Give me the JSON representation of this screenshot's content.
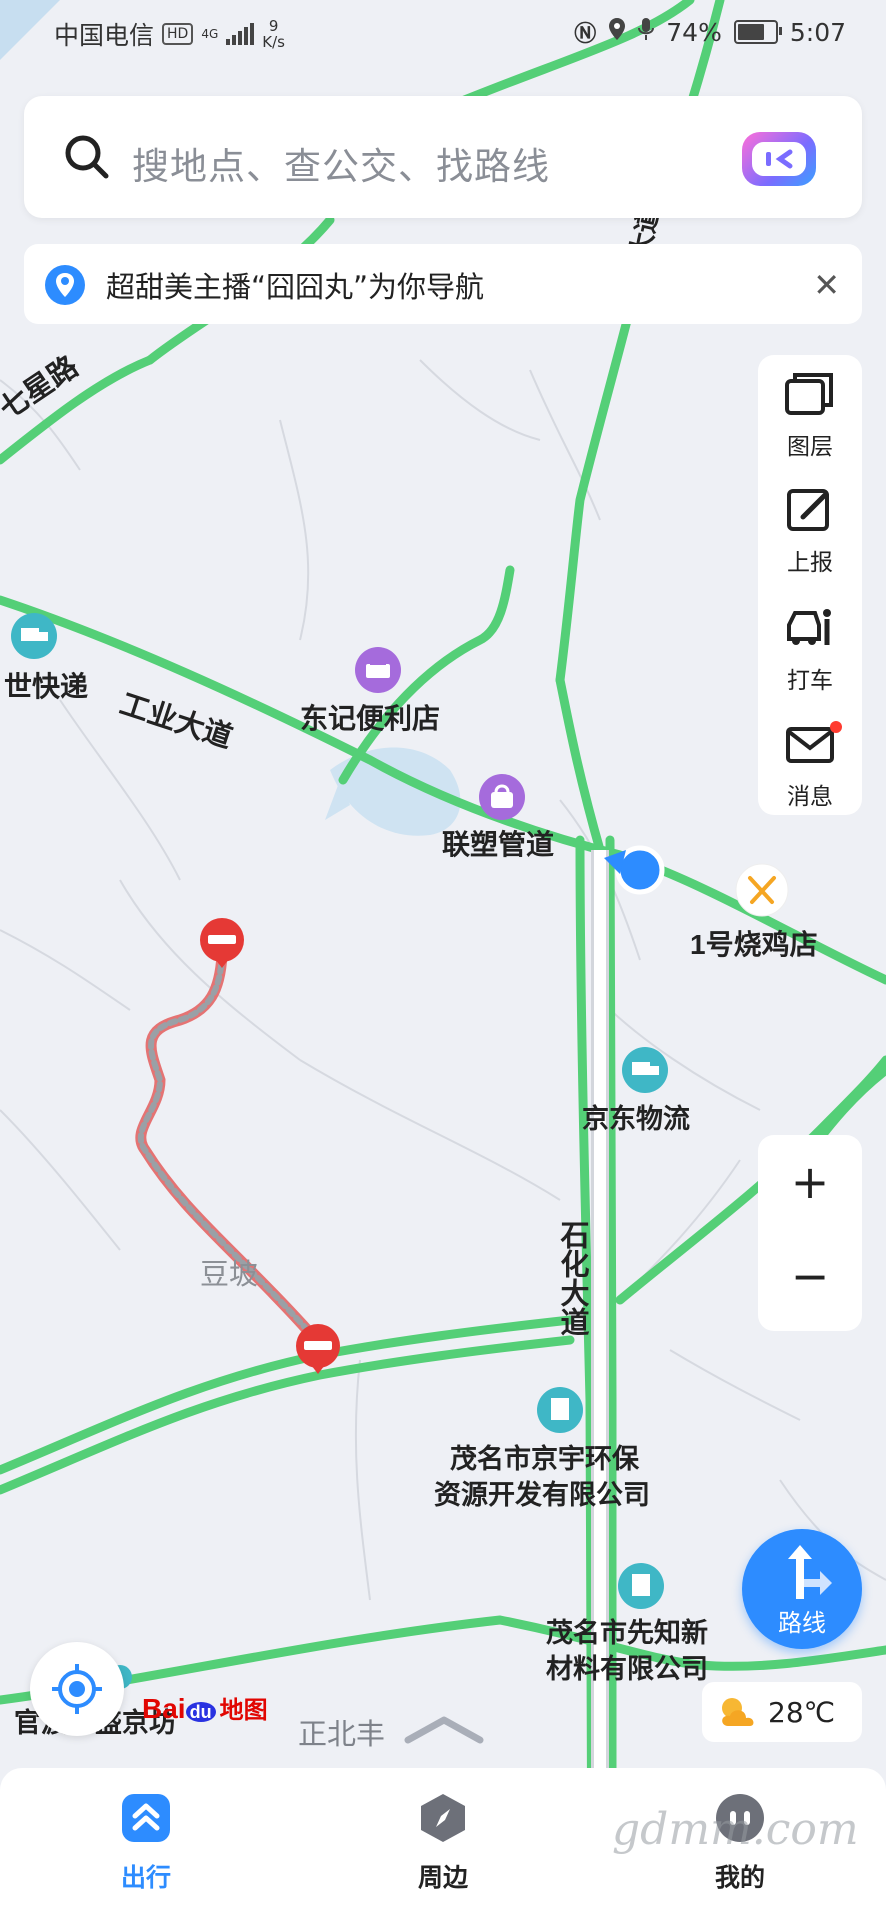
{
  "status_bar": {
    "carrier": "中国电信",
    "hd": "HD",
    "network": "4G",
    "speed_value": "9",
    "speed_unit": "K/s",
    "battery": "74%",
    "time": "5:07"
  },
  "search": {
    "placeholder": "搜地点、查公交、找路线"
  },
  "notice": {
    "text": "超甜美主播“囧囧丸”为你导航"
  },
  "tools": [
    {
      "label": "图层",
      "icon": "layers-icon"
    },
    {
      "label": "上报",
      "icon": "report-edit-icon"
    },
    {
      "label": "打车",
      "icon": "taxi-icon"
    },
    {
      "label": "消息",
      "icon": "mail-icon"
    }
  ],
  "zoom": {
    "in": "+",
    "out": "−"
  },
  "route_button": {
    "label": "路线"
  },
  "weather": {
    "temp": "28℃"
  },
  "compass": {
    "text": "正北丰"
  },
  "logo": {
    "bai": "Bai",
    "du": "du",
    "ditu": "地图"
  },
  "tabs": [
    {
      "label": "出行",
      "active": true
    },
    {
      "label": "周边",
      "active": false
    },
    {
      "label": "我的",
      "active": false
    }
  ],
  "map_labels": {
    "qixing_road": "七星路",
    "gongye_road": "工业大道",
    "shihua_road": "石化大道",
    "dongji_store": "东记便利店",
    "liansu": "联塑管道",
    "shaoji": "1号烧鸡店",
    "jingdong": "京东物流",
    "doupo": "豆坡",
    "jingyu_line1": "茂名市京宇环保",
    "jingyu_line2": "资源开发有限公司",
    "xianzhi_line1": "茂名市先知新",
    "xianzhi_line2": "材料有限公司",
    "shikuaidi": "世快递",
    "bottom_left_road": "官渡一盛京坊",
    "top_right_road": "大道"
  },
  "watermark": "gdmm.com",
  "colors": {
    "road_green": "#54cf77",
    "accent_blue": "#2d8cff",
    "closure_red": "#e53935",
    "poi_purple": "#a56bdc",
    "poi_teal": "#3fb7c6"
  }
}
